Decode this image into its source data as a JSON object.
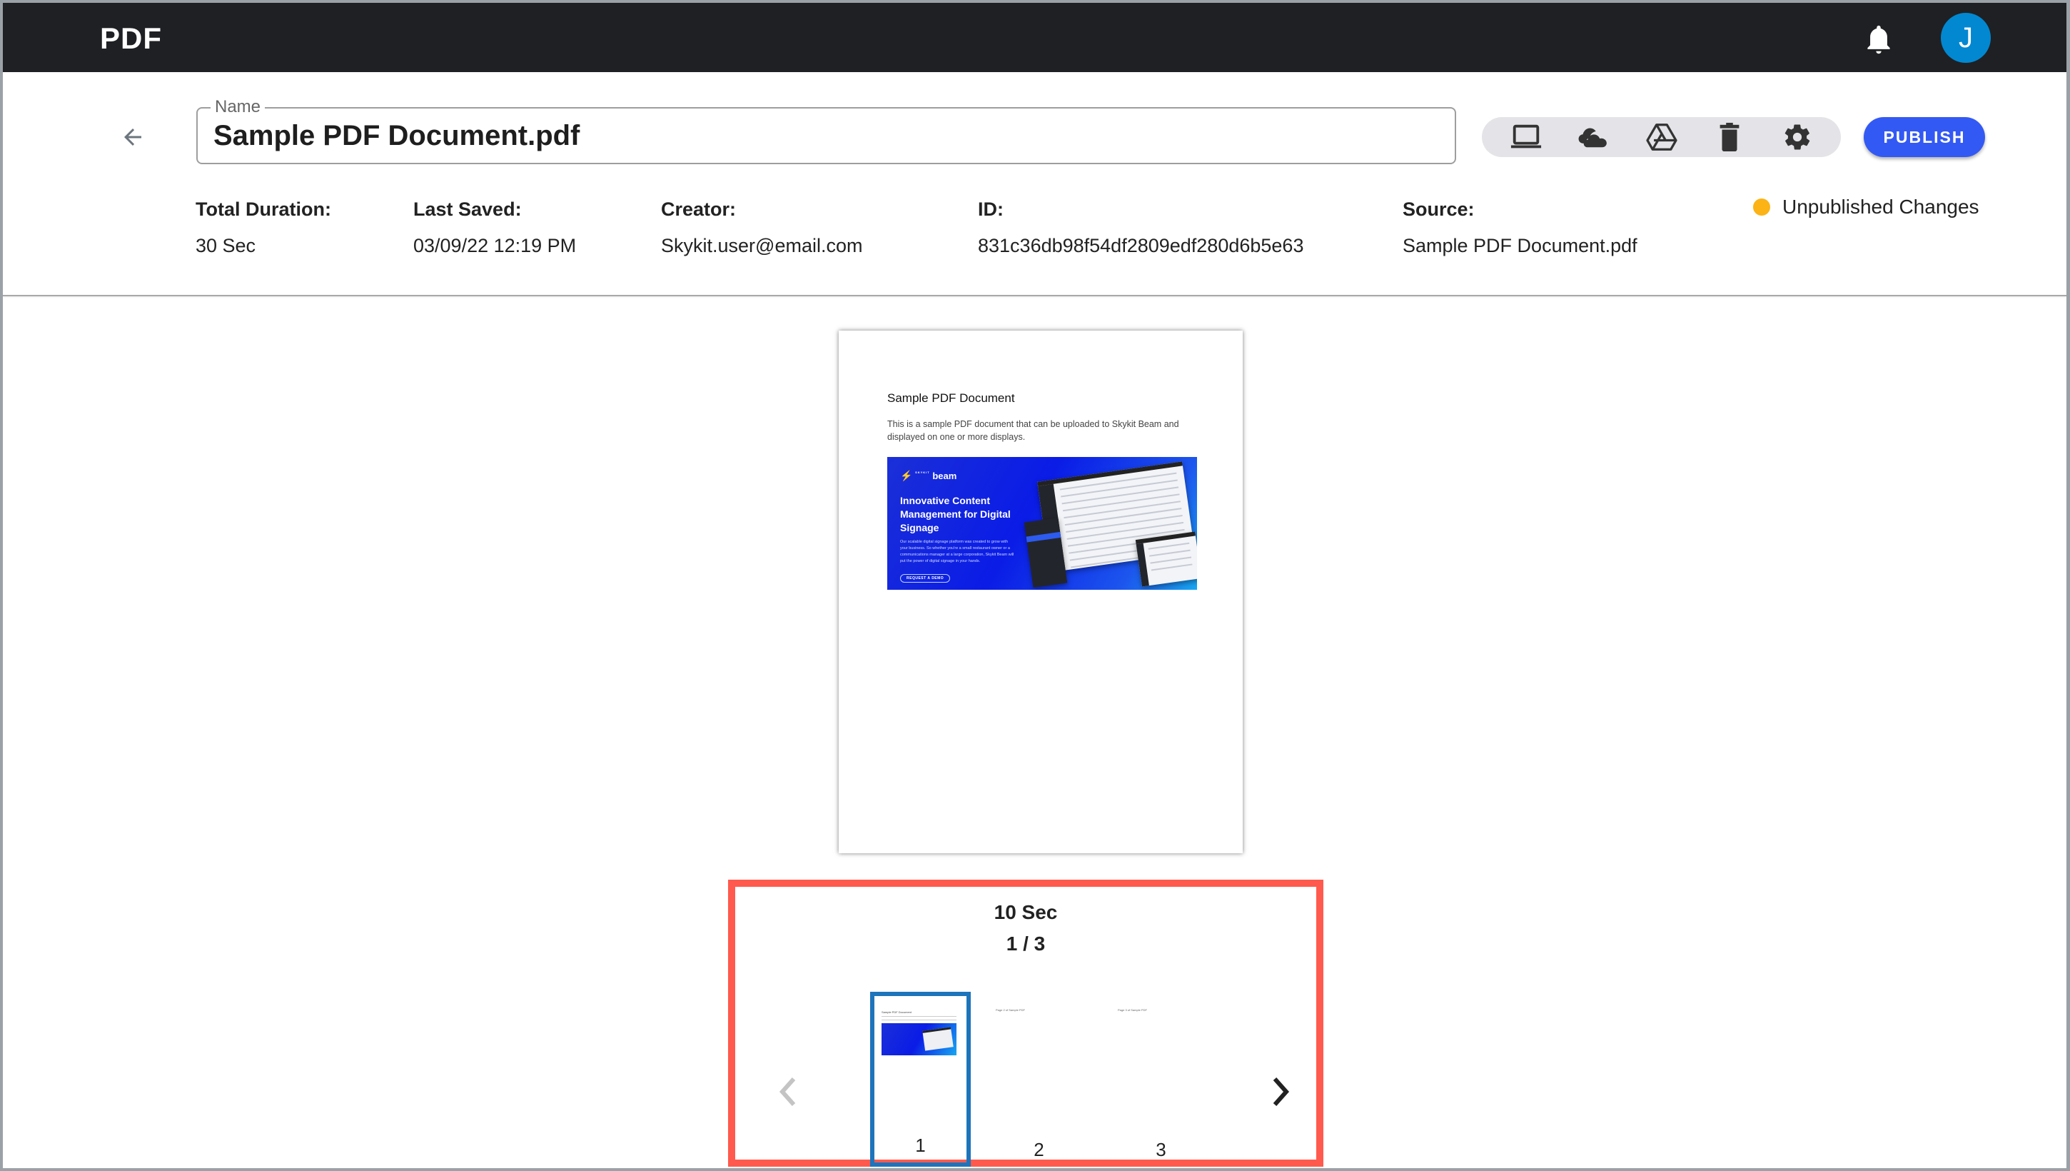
{
  "app": {
    "title": "PDF",
    "avatar_initial": "J",
    "colors": {
      "appbar": "#1f2023",
      "avatar": "#0288d1",
      "accent": "#3359f4",
      "status_unpublished": "#fbb315",
      "selection": "#1e74bb",
      "highlight_box": "#ff5a4d"
    }
  },
  "header": {
    "back_icon": "arrow-left-icon",
    "name_label": "Name",
    "name_value": "Sample PDF Document.pdf",
    "toolbar": [
      {
        "name": "display-button",
        "icon": "laptop-icon"
      },
      {
        "name": "onedrive-button",
        "icon": "cloud-icon"
      },
      {
        "name": "google-drive-button",
        "icon": "google-drive-icon"
      },
      {
        "name": "delete-button",
        "icon": "trash-icon"
      },
      {
        "name": "settings-button",
        "icon": "gear-icon"
      }
    ],
    "publish_label": "PUBLISH",
    "status": "Unpublished Changes"
  },
  "meta": {
    "total_duration": {
      "label": "Total Duration:",
      "value": "30 Sec"
    },
    "last_saved": {
      "label": "Last Saved:",
      "value": "03/09/22 12:19 PM"
    },
    "creator": {
      "label": "Creator:",
      "value": "Skykit.user@email.com"
    },
    "id": {
      "label": "ID:",
      "value": "831c36db98f54df2809edf280d6b5e63"
    },
    "source": {
      "label": "Source:",
      "value": "Sample PDF Document.pdf"
    }
  },
  "preview": {
    "title": "Sample PDF Document",
    "body": "This is a sample PDF document that can be uploaded to Skykit Beam and displayed on one or more displays.",
    "banner": {
      "brand_small": "SKYKIT",
      "brand": "beam",
      "headline": "Innovative Content Management for Digital Signage",
      "text": "Our scalable digital signage platform was created to grow with your business. So whether you're a small restaurant owner or a communications manager at a large corporation, Skykit Beam will put the power of digital signage in your hands.",
      "cta": "REQUEST A DEMO"
    }
  },
  "selector": {
    "duration": "10 Sec",
    "counter": "1 / 3",
    "current_page": 1,
    "total_pages": 3,
    "thumbnails": [
      {
        "number": "1",
        "caption": "Sample PDF Document",
        "selected": true
      },
      {
        "number": "2",
        "caption": "Page 2 of Sample PDF",
        "selected": false
      },
      {
        "number": "3",
        "caption": "Page 3 of Sample PDF",
        "selected": false
      }
    ]
  }
}
